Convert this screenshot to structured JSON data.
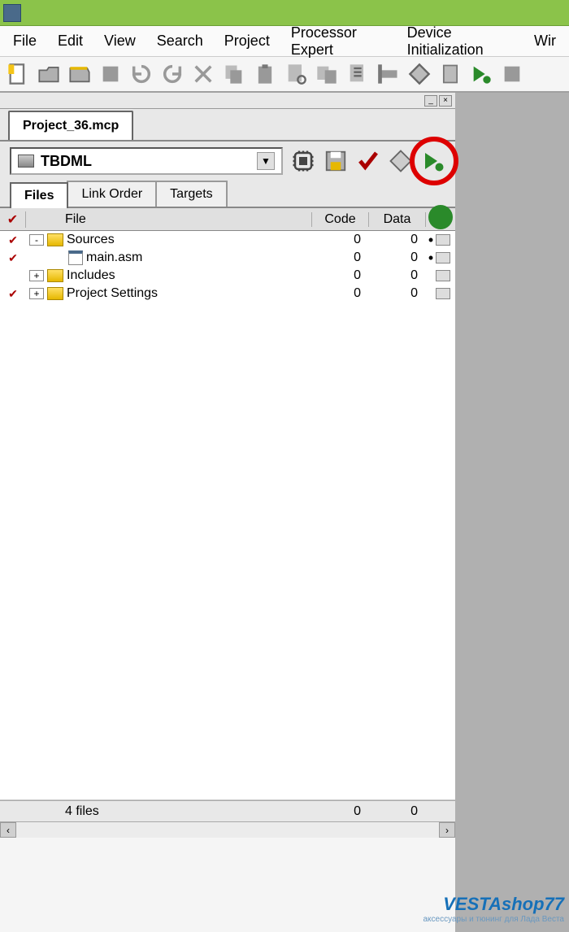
{
  "menu": {
    "items": [
      "File",
      "Edit",
      "View",
      "Search",
      "Project",
      "Processor Expert",
      "Device Initialization",
      "Wir"
    ]
  },
  "toolbar_icons": [
    "new-doc-icon",
    "open-icon",
    "save-icon",
    "stop-icon",
    "undo-icon",
    "redo-icon",
    "cut-icon",
    "copy-icon",
    "paste-icon",
    "find-icon",
    "replace-icon",
    "errors-icon",
    "marker-icon",
    "diamond-icon",
    "doc-icon",
    "debug-arrow-icon",
    "stop-square-icon"
  ],
  "document": {
    "tab_title": "Project_36.mcp",
    "target": "TBDML",
    "proj_tool_icons": [
      "chip-icon",
      "disk-icon",
      "check-icon",
      "build-icon",
      "run-debug-icon"
    ],
    "sub_tabs": [
      "Files",
      "Link Order",
      "Targets"
    ],
    "headers": {
      "file": "File",
      "code": "Code",
      "data": "Data"
    },
    "rows": [
      {
        "check": true,
        "indent": 0,
        "expander": "-",
        "type": "folder",
        "name": "Sources",
        "code": "0",
        "data": "0",
        "dot": "•"
      },
      {
        "check": true,
        "indent": 2,
        "expander": "",
        "type": "file",
        "name": "main.asm",
        "code": "0",
        "data": "0",
        "dot": "•"
      },
      {
        "check": false,
        "indent": 0,
        "expander": "+",
        "type": "folder",
        "name": "Includes",
        "code": "0",
        "data": "0",
        "dot": ""
      },
      {
        "check": true,
        "indent": 0,
        "expander": "+",
        "type": "folder",
        "name": "Project Settings",
        "code": "0",
        "data": "0",
        "dot": ""
      }
    ],
    "summary": {
      "files": "4 files",
      "code": "0",
      "data": "0"
    }
  },
  "watermark": {
    "main": "VESTAshop77",
    "sub": "аксессуары и тюнинг для Лада Веста"
  }
}
